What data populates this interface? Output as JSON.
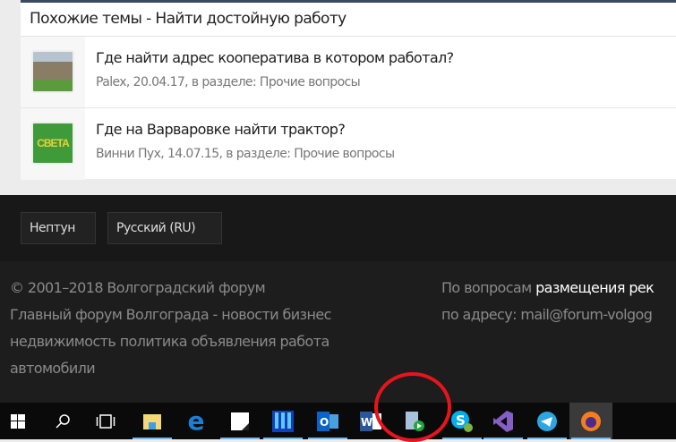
{
  "similar": {
    "title": "Похожие темы - Найти достойную работу",
    "items": [
      {
        "title": "Где найти адрес кооператива в котором работал?",
        "meta": "Palex, 20.04.17, в разделе: Прочие вопросы"
      },
      {
        "title": "Где на Варваровке найти трактор?",
        "meta": "Винни Пух, 14.07.15, в разделе: Прочие вопросы",
        "thumb_text": "СВЕТА"
      }
    ]
  },
  "footer": {
    "style_button": "Нептун",
    "language_button": "Русский (RU)",
    "copyright": "© 2001–2018 Волгоградский форум",
    "description": "Главный форум Волгограда - новости бизнес недвижимость политика объявления работа автомобили",
    "contact_prefix": "По вопросам ",
    "contact_link": "размещения рек",
    "contact_address": "по адресу: mail@forum-volgog"
  },
  "taskbar": {
    "icons": [
      "windows-start",
      "search",
      "task-view",
      "file-explorer",
      "edge",
      "sticky-notes",
      "app-blue",
      "outlook",
      "word",
      "media-app",
      "skype",
      "visual-studio",
      "telegram",
      "firefox"
    ]
  }
}
